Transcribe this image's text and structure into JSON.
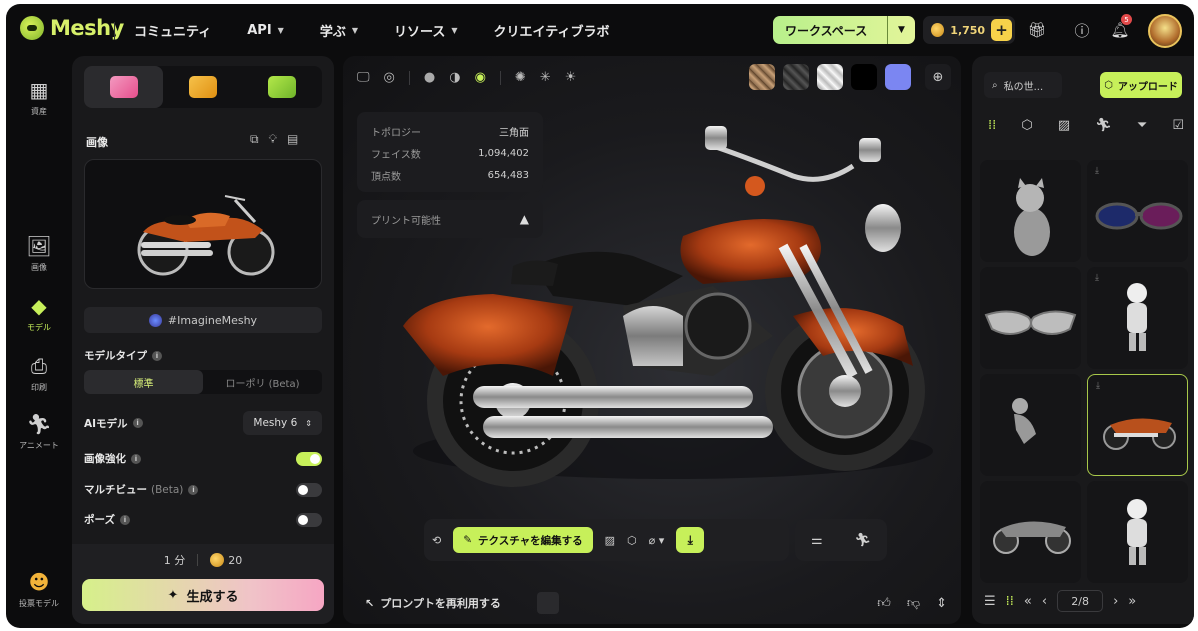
{
  "app": {
    "name": "Meshy"
  },
  "nav": {
    "items": [
      {
        "label": "コミュニティ",
        "dropdown": false
      },
      {
        "label": "API",
        "dropdown": true
      },
      {
        "label": "学ぶ",
        "dropdown": true
      },
      {
        "label": "リソース",
        "dropdown": true
      },
      {
        "label": "クリエイティブラボ",
        "dropdown": false
      }
    ]
  },
  "header": {
    "workspace_label": "ワークスペース",
    "credits": "1,750",
    "notification_count": "5"
  },
  "rail": {
    "items": [
      {
        "label": "資産",
        "icon": "grid-icon"
      },
      {
        "label": "画像",
        "icon": "image-plus-icon"
      },
      {
        "label": "モデル",
        "icon": "cube-icon"
      },
      {
        "label": "印刷",
        "icon": "printer-icon"
      },
      {
        "label": "アニメート",
        "icon": "running-icon"
      },
      {
        "label": "投票モデル",
        "icon": "vote-icon"
      }
    ]
  },
  "left": {
    "image_section": "画像",
    "hashtag": "#ImagineMeshy",
    "model_type_label": "モデルタイプ",
    "model_type_options": [
      "標準",
      "ローポリ (Beta)"
    ],
    "ai_model_label": "AIモデル",
    "ai_model_value": "Meshy 6",
    "image_enhance_label": "画像強化",
    "multiview_label": "マルチビュー",
    "multiview_beta": "(Beta)",
    "pose_label": "ポーズ",
    "time_cost": "1 分",
    "credit_cost": "20",
    "generate_label": "生成する"
  },
  "viewer": {
    "swatch_colors": [
      "#8a6b4d",
      "#3a3a3a",
      "#d9d9d9",
      "#000000",
      "#7b86f2"
    ],
    "stats": [
      {
        "k": "トポロジー",
        "v": "三角面"
      },
      {
        "k": "フェイス数",
        "v": "1,094,402"
      },
      {
        "k": "頂点数",
        "v": "654,483"
      }
    ],
    "print_label": "プリント可能性",
    "edit_texture_label": "テクスチャを編集する",
    "reuse_prompt_label": "プロンプトを再利用する"
  },
  "right": {
    "search_placeholder": "私の世...",
    "upload_label": "アップロード",
    "page_indicator": "2/8"
  }
}
